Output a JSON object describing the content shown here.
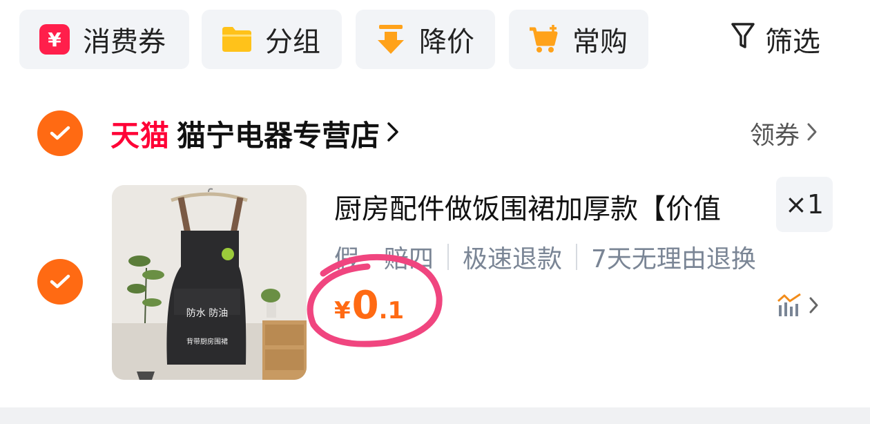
{
  "toolbar": {
    "items": [
      {
        "label": "消费券",
        "icon": "coupon-icon"
      },
      {
        "label": "分组",
        "icon": "folder-icon"
      },
      {
        "label": "降价",
        "icon": "price-drop-icon"
      },
      {
        "label": "常购",
        "icon": "cart-plus-icon"
      }
    ],
    "filter_label": "筛选"
  },
  "store": {
    "platform": "天猫",
    "name": "猫宁电器专营店",
    "coupon_label": "领券"
  },
  "product": {
    "title": "厨房配件做饭围裙加厚款【价值",
    "quantity": "×1",
    "tags": [
      "假一赔四",
      "极速退款",
      "7天无理由退换"
    ],
    "price_currency": "¥",
    "price_int": "0",
    "price_dec": ".1",
    "image_text_1": "防水  防油",
    "image_text_2": "背带厨房围裙"
  },
  "colors": {
    "accent": "#ff6a13",
    "tmall": "#ff0036",
    "annotation": "#f0457f"
  }
}
